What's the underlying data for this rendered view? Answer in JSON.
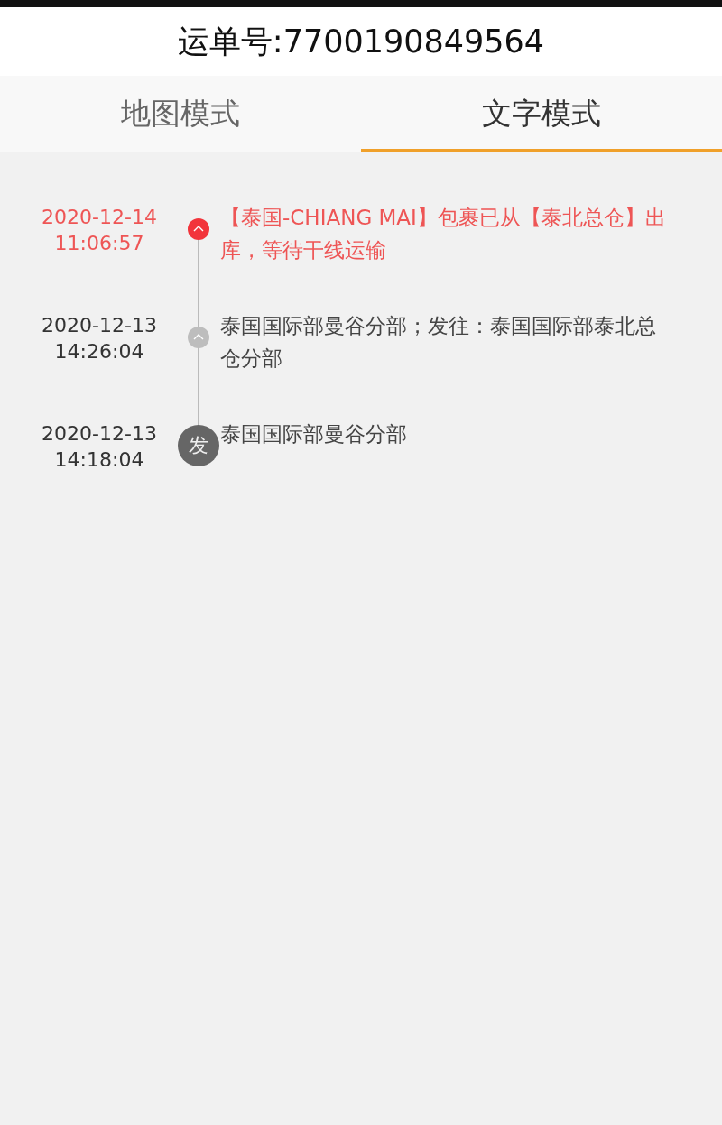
{
  "header": {
    "title": "运单号:7700190849564"
  },
  "tabs": [
    {
      "label": "地图模式",
      "selected": false
    },
    {
      "label": "文字模式",
      "selected": true
    }
  ],
  "events": [
    {
      "kind": "latest",
      "date": "2020-12-14",
      "time": "11:06:57",
      "text": "【泰国-CHIANG MAI】包裹已从【泰北总仓】出库，等待干线运输"
    },
    {
      "kind": "transit",
      "date": "2020-12-13",
      "time": "14:26:04",
      "text": "泰国国际部曼谷分部；发往：泰国国际部泰北总仓分部"
    },
    {
      "kind": "origin",
      "badge": "发",
      "date": "2020-12-13",
      "time": "14:18:04",
      "text": "泰国国际部曼谷分部"
    }
  ]
}
